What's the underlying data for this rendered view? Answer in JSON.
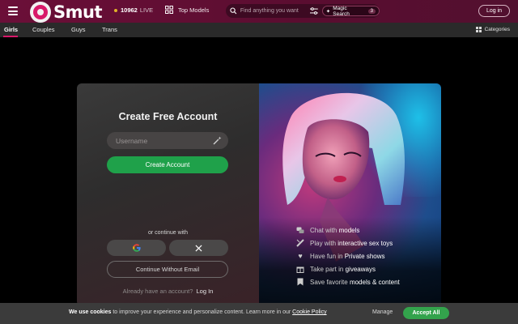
{
  "header": {
    "logo_text": "Smut",
    "live_count": "10962",
    "live_label": "LIVE",
    "top_models": "Top Models",
    "search_placeholder": "Find anything you want",
    "magic_search": "Magic Search",
    "magic_count": "3",
    "login": "Log in"
  },
  "nav": {
    "items": [
      "Girls",
      "Couples",
      "Guys",
      "Trans"
    ],
    "categories": "Categories"
  },
  "signup": {
    "title": "Create Free Account",
    "username_placeholder": "Username",
    "create_button": "Create Account",
    "or_continue": "or continue with",
    "no_email": "Continue Without Email",
    "already_text": "Already have an account?",
    "login_link": "Log In"
  },
  "features": [
    {
      "pre": "Chat with",
      "bold": "models",
      "icon": "chat-icon"
    },
    {
      "pre": "Play with",
      "bold": "interactive sex toys",
      "icon": "toy-icon"
    },
    {
      "pre": "Have fun in",
      "bold": "Private shows",
      "icon": "heart-icon"
    },
    {
      "pre": "Take part in",
      "bold": "giveaways",
      "icon": "gift-icon"
    },
    {
      "pre": "Save favorite",
      "bold": "models & content",
      "icon": "bookmark-icon"
    }
  ],
  "cookie": {
    "lead": "We use cookies",
    "text": "to improve your experience and personalize content. Learn more in our",
    "policy": "Cookie Policy",
    "manage": "Manage",
    "accept": "Accept All"
  },
  "colors": {
    "brand": "#d8196a",
    "header_bg": "#6b0f38",
    "accept_green": "#33a34c",
    "create_green": "#1fa14a"
  }
}
